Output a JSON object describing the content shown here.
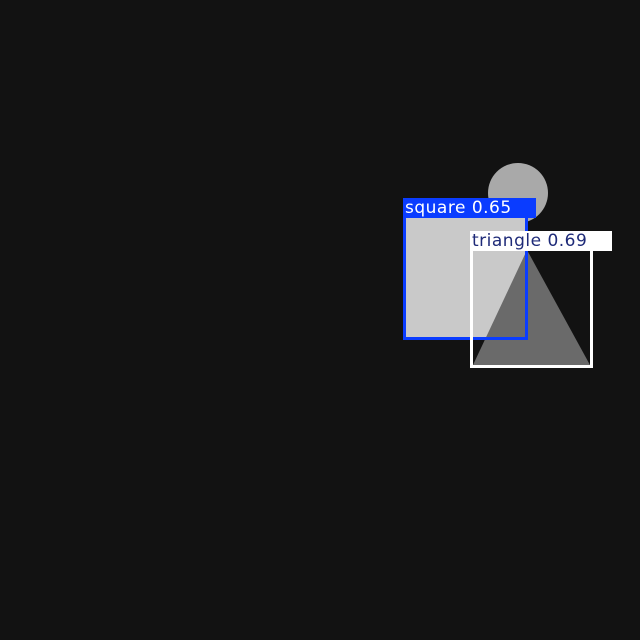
{
  "colors": {
    "background": "#121212",
    "circle": "#a9a9a9",
    "square": "#c9c9c9",
    "triangle": "#6a6a6a",
    "square_box": "#0a3cff",
    "triangle_box": "#ffffff",
    "triangle_label_text": "#1e2a78"
  },
  "detections": [
    {
      "label": "square 0.65"
    },
    {
      "label": "triangle 0.69"
    }
  ]
}
